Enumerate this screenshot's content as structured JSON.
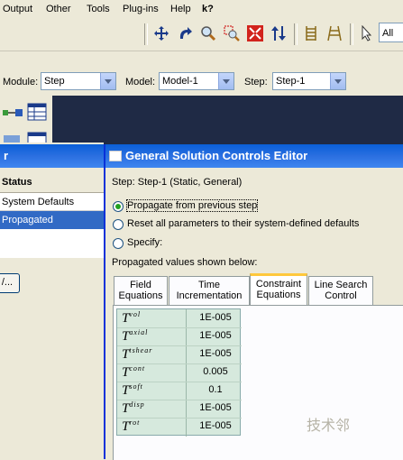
{
  "menu": {
    "items": [
      {
        "label": "Output"
      },
      {
        "label": "Other"
      },
      {
        "label": "Tools"
      },
      {
        "label": "Plug-ins"
      },
      {
        "label": "Help"
      },
      {
        "label": "k?"
      }
    ]
  },
  "toolbar": {
    "icons": [
      "move-icon",
      "rotate-icon",
      "zoom-icon",
      "box-zoom-icon",
      "fit-view-icon",
      "vertical-arrows-icon",
      "grid-icon",
      "ladder-icon",
      "pointer-icon"
    ],
    "selection_filter": "All"
  },
  "context": {
    "module_label": "Module:",
    "module_value": "Step",
    "model_label": "Model:",
    "model_value": "Model-1",
    "step_label": "Step:",
    "step_value": "Step-1"
  },
  "left_panel": {
    "title": "r",
    "header": "Status",
    "rows": [
      "System Defaults",
      "Propagated"
    ],
    "button_label": "/..."
  },
  "dialog": {
    "title": "General Solution Controls Editor",
    "step_text": "Step:  Step-1 (Static, General)",
    "options": [
      {
        "label": "Propagate from previous step",
        "checked": true
      },
      {
        "label": "Reset all parameters to their system-defined defaults",
        "checked": false
      },
      {
        "label": "Specify:",
        "checked": false
      }
    ],
    "propagated_caption": "Propagated values shown below:",
    "tabs": [
      {
        "line1": "Field",
        "line2": "Equations",
        "active": false
      },
      {
        "line1": "Time",
        "line2": "Incrementation",
        "active": false
      },
      {
        "line1": "Constraint",
        "line2": "Equations",
        "active": true
      },
      {
        "line1": "Line Search",
        "line2": "Control",
        "active": false
      }
    ],
    "table": [
      {
        "sym": "T",
        "sup": "vol",
        "value": "1E-005"
      },
      {
        "sym": "T",
        "sup": "axial",
        "value": "1E-005"
      },
      {
        "sym": "T",
        "sup": "tshear",
        "value": "1E-005"
      },
      {
        "sym": "T",
        "sup": "cont",
        "value": "0.005"
      },
      {
        "sym": "T",
        "sup": "soft",
        "value": "0.1"
      },
      {
        "sym": "T",
        "sup": "disp",
        "value": "1E-005"
      },
      {
        "sym": "T",
        "sup": "rot",
        "value": "1E-005"
      }
    ]
  },
  "watermark": "技术邻"
}
